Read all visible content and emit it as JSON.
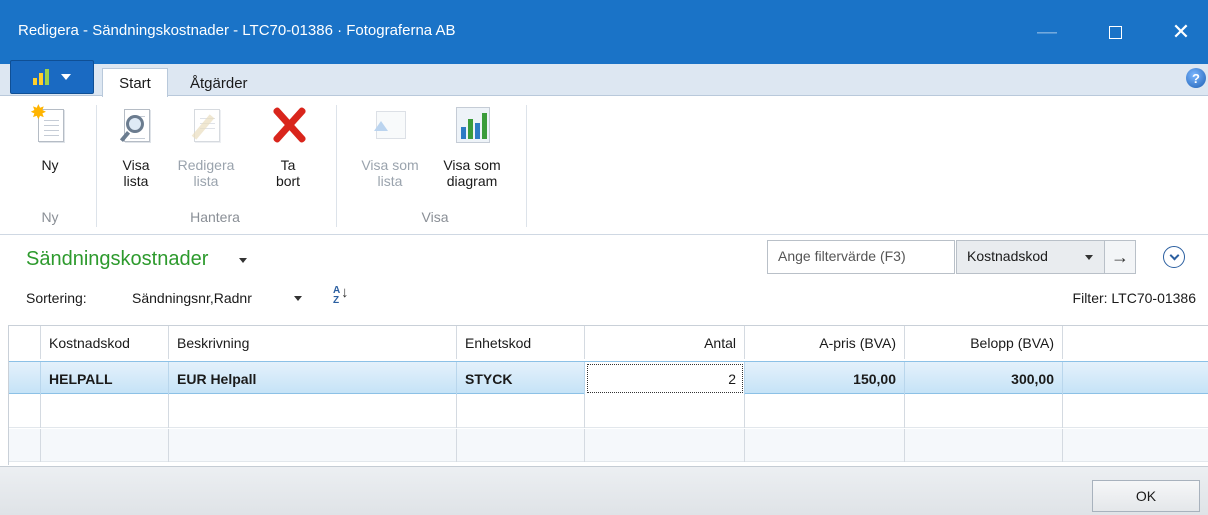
{
  "window": {
    "title": "Redigera - Sändningskostnader - LTC70-01386 · Fotograferna AB",
    "minimize": "—",
    "close": "✕"
  },
  "ribbon_tabs": {
    "start": "Start",
    "actions": "Åtgärder",
    "help": "?"
  },
  "ribbon": {
    "new": "Ny",
    "show_list": "Visa lista",
    "edit_list": "Redigera lista",
    "delete": "Ta bort",
    "show_as_list": "Visa som lista",
    "show_as_chart": "Visa som diagram",
    "group_new": "Ny",
    "group_manage": "Hantera",
    "group_show": "Visa"
  },
  "list": {
    "title": "Sändningskostnader",
    "filter_placeholder": "Ange filtervärde (F3)",
    "filter_field": "Kostnadskod",
    "filter_arrow": "→",
    "sort_label": "Sortering:",
    "sort_value": "Sändningsnr,Radnr",
    "sort_icon_a": "A",
    "sort_icon_z": "Z",
    "sort_icon_arrow": "↓",
    "filter_info": "Filter: LTC70-01386"
  },
  "table": {
    "columns": [
      "Kostnadskod",
      "Beskrivning",
      "Enhetskod",
      "Antal",
      "A-pris (BVA)",
      "Belopp (BVA)"
    ],
    "rows": [
      [
        "HELPALL",
        "EUR Helpall",
        "STYCK",
        "2",
        "150,00",
        "300,00"
      ]
    ]
  },
  "footer": {
    "ok": "OK"
  },
  "colors": {
    "titlebar": "#1a73c7",
    "list_title": "#2d9a2d",
    "delete_icon": "#d9251c"
  }
}
